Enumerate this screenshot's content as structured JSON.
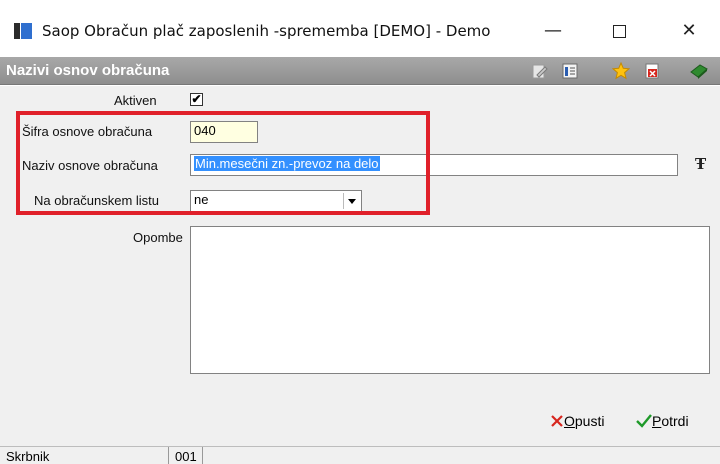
{
  "window": {
    "title": "Saop Obračun plač zaposlenih -sprememba [DEMO] - Demo",
    "minimize_glyph": "—",
    "close_glyph": "✕"
  },
  "header": {
    "title": "Nazivi osnov obračuna",
    "toolbar_icons": [
      "edit-icon",
      "list-icon",
      "star-icon",
      "delete-icon",
      "book-icon"
    ]
  },
  "form": {
    "aktiven_label": "Aktiven",
    "aktiven_checked": true,
    "aktiven_glyph": "✔",
    "sifra_label": "Šifra osnove obračuna",
    "sifra_value": "040",
    "naziv_label": "Naziv osnove obračuna",
    "naziv_value": "Min.mesečni zn.-prevoz na delo",
    "font_icon_glyph": "Ŧ",
    "na_obracunskem_label": "Na obračunskem listu",
    "na_obracunskem_value": "ne",
    "opombe_label": "Opombe",
    "opombe_value": ""
  },
  "actions": {
    "cancel_u": "O",
    "cancel_rest": "pusti",
    "confirm_u": "P",
    "confirm_rest": "otrdi"
  },
  "status": {
    "user": "Skrbnik",
    "code": "001"
  },
  "colors": {
    "highlight": "#e0202a",
    "selection": "#3390ff",
    "code_field_bg": "#ffffe1"
  }
}
